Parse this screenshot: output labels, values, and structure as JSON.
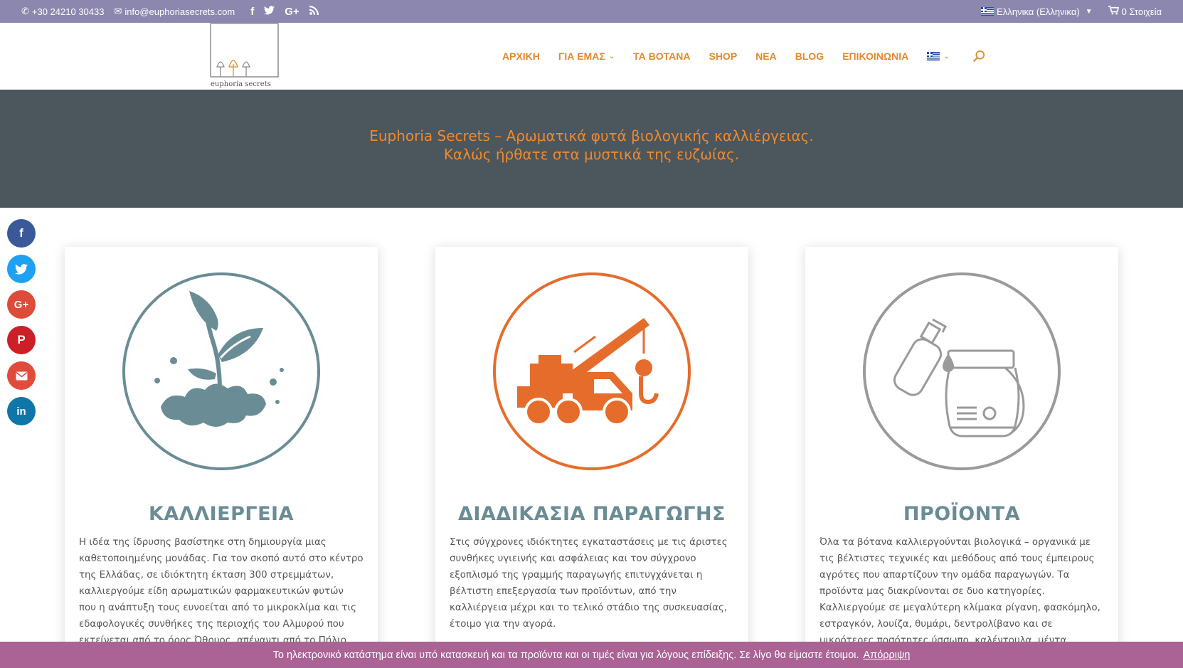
{
  "topbar": {
    "phone": "+30 24210 30433",
    "email": "info@euphoriasecrets.com",
    "language": "Ελληνικα (Ελληνικα)",
    "cart": "0 Στοιχεία"
  },
  "logo": {
    "text": "euphoria secrets"
  },
  "nav": {
    "items": [
      "ΑΡΧΙΚΗ",
      "ΓΙΑ ΕΜΑΣ",
      "ΤΑ ΒΟΤΑΝΑ",
      "SHOP",
      "ΝΕΑ",
      "BLOG",
      "ΕΠΙΚΟΙΝΩΝΙΑ"
    ]
  },
  "hero": {
    "line1": "Euphoria Secrets – Αρωματικά φυτά βιολογικής καλλιέργειας.",
    "line2": "Καλώς ήρθατε στα μυστικά της ευζωίας."
  },
  "cards": [
    {
      "title": "ΚΑΛΛΙΕΡΓΕΙΑ",
      "color": "#6a8c95",
      "text": "Η ιδέα της ίδρυσης βασίστηκε στη δημιουργία μιας καθετοποιημένης μονάδας. Για τον σκοπό αυτό στο κέντρο της Ελλάδας, σε ιδιόκτητη έκταση 300 στρεμμάτων, καλλιεργούμε είδη αρωματικών φαρμακευτικών φυτών  που η ανάπτυξη τους ευνοείται από το μικροκλίμα και τις εδαφολογικές συνθήκες της περιοχής του Αλμυρού που εκτείνεται από το όρος Όθρυος, απέναντι από το Πήλιο και"
    },
    {
      "title": "ΔΙΑΔΙΚΑΣΙΑ ΠΑΡΑΓΩΓΗΣ",
      "color": "#6a8c95",
      "text": "Στις σύγχρονες ιδιόκτητες εγκαταστάσεις με τις άριστες συνθήκες υγιεινής και ασφάλειας και τον σύγχρονο εξοπλισμό της γραμμής παραγωγής επιτυγχάνεται η βέλτιστη επεξεργασία των προϊόντων, από την καλλιέργεια μέχρι και το τελικό στάδιο της συσκευασίας, έτοιμο για την αγορά."
    },
    {
      "title": "ΠΡΟΪΟΝΤΑ",
      "color": "#6a8c95",
      "text": "Όλα τα βότανα καλλιεργούνται βιολογικά – οργανικά με τις βέλτιστες τεχνικές και μεθόδους από τους έμπειρους αγρότες που απαρτίζουν την ομάδα παραγωγών. Τα προϊόντα μας διακρίνονται σε δυο κατηγορίες. Καλλιεργούμε σε μεγαλύτερη κλίμακα ρίγανη, φασκόμηλο, εστραγκόν, λουίζα, θυμάρι, δεντρολίβανο και σε μικρότερες ποσότητες ύσσωπο, καλέντουλα, μέντα, αχιλλέα και άλλα"
    }
  ],
  "social": {
    "facebook": "f",
    "twitter": "t",
    "googleplus": "G+",
    "pinterest": "P",
    "email": "@",
    "linkedin": "in"
  },
  "cookie": {
    "message": "Το ηλεκτρονικό κατάστημα είναι υπό κατασκευή και τα προϊόντα και οι τιμές είναι για λόγους επίδειξης. Σε λίγο θα είμαστε έτοιμοι.",
    "dismiss": "Απόρριψη"
  },
  "colors": {
    "topbar": "#8c87ae",
    "accent": "#e08a2c",
    "hero_bg": "#4b565d",
    "cookie_bg": "#ab6295"
  }
}
